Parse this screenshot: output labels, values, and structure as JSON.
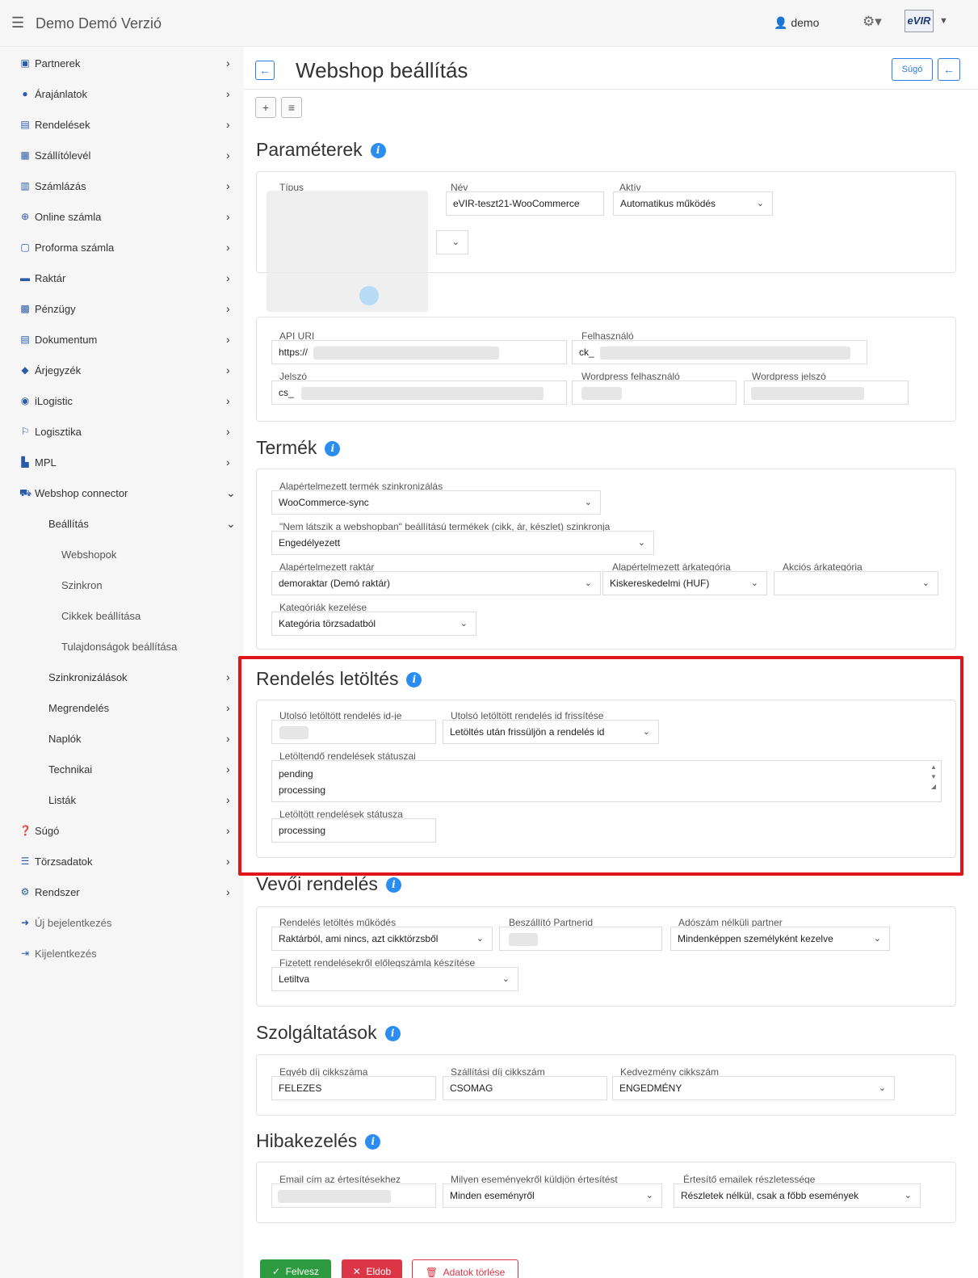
{
  "app": {
    "title": "Demo Demó Verzió",
    "user": "demo",
    "logo": "eVIR"
  },
  "sidebar": {
    "items": [
      {
        "label": "Partnerek",
        "icon": "building-icon"
      },
      {
        "label": "Árajánlatok",
        "icon": "chat-icon"
      },
      {
        "label": "Rendelések",
        "icon": "doc-icon"
      },
      {
        "label": "Szállítólevél",
        "icon": "box-icon"
      },
      {
        "label": "Számlázás",
        "icon": "invoice-icon"
      },
      {
        "label": "Online számla",
        "icon": "globe-icon"
      },
      {
        "label": "Proforma számla",
        "icon": "proforma-icon"
      },
      {
        "label": "Raktár",
        "icon": "warehouse-icon"
      },
      {
        "label": "Pénzügy",
        "icon": "money-icon"
      },
      {
        "label": "Dokumentum",
        "icon": "document-icon"
      },
      {
        "label": "Árjegyzék",
        "icon": "tag-icon"
      },
      {
        "label": "iLogistic",
        "icon": "ilogistic-icon"
      },
      {
        "label": "Logisztika",
        "icon": "truck-icon"
      },
      {
        "label": "MPL",
        "icon": "mpl-icon"
      },
      {
        "label": "Webshop connector",
        "icon": "cart-icon"
      }
    ],
    "sub_items": [
      {
        "label": "Beállítás",
        "level": 2
      },
      {
        "label": "Webshopok",
        "level": 3
      },
      {
        "label": "Szinkron",
        "level": 3
      },
      {
        "label": "Cikkek beállítása",
        "level": 3
      },
      {
        "label": "Tulajdonságok beállítása",
        "level": 3
      },
      {
        "label": "Szinkronizálások",
        "level": 2
      },
      {
        "label": "Megrendelés",
        "level": 2
      },
      {
        "label": "Naplók",
        "level": 2
      },
      {
        "label": "Technikai",
        "level": 2
      },
      {
        "label": "Listák",
        "level": 2
      }
    ],
    "bottom_items": [
      {
        "label": "Súgó",
        "icon": "question-icon"
      },
      {
        "label": "Törzsadatok",
        "icon": "database-icon"
      },
      {
        "label": "Rendszer",
        "icon": "settings-icon"
      },
      {
        "label": "Új bejelentkezés",
        "icon": "login-icon"
      },
      {
        "label": "Kijelentkezés",
        "icon": "logout-icon"
      }
    ]
  },
  "page": {
    "title": "Webshop beállítás",
    "help_label": "Súgó"
  },
  "parameters": {
    "title": "Paraméterek",
    "type_label": "Típus",
    "name_label": "Név",
    "name_value": "eVIR-teszt21-WooCommerce",
    "active_label": "Aktív",
    "active_value": "Automatikus működés"
  },
  "connection": {
    "title": "",
    "api_uri_label": "API URI",
    "api_uri_value": "https://",
    "user_label": "Felhasználó",
    "user_value": "ck_",
    "password_label": "Jelszó",
    "password_value": "cs_",
    "wp_user_label": "Wordpress felhasználó",
    "wp_password_label": "Wordpress jelszó"
  },
  "product": {
    "title": "Termék",
    "sync_label": "Alapértelmezett termék szinkronizálás",
    "sync_value": "WooCommerce-sync",
    "hidden_label": "\"Nem látszik a webshopban\" beállítású termékek (cikk, ár, készlet) szinkronja",
    "hidden_value": "Engedélyezett",
    "warehouse_label": "Alapértelmezett raktár",
    "warehouse_value": "demoraktar (Demó raktár)",
    "price_cat_label": "Alapértelmezett árkategória",
    "price_cat_value": "Kiskereskedelmi (HUF)",
    "sale_cat_label": "Akciós árkategória",
    "sale_cat_value": "",
    "cat_handling_label": "Kategóriák kezelése",
    "cat_handling_value": "Kategória törzsadatból"
  },
  "order_download": {
    "title": "Rendelés letöltés",
    "last_id_label": "Utolsó letöltött rendelés id-je",
    "last_id_refresh_label": "Utolsó letöltött rendelés id frissítése",
    "last_id_refresh_value": "Letöltés után frissüljön a rendelés id",
    "statuses_label": "Letöltendő rendelések státuszai",
    "statuses": [
      "pending",
      "processing"
    ],
    "downloaded_status_label": "Letöltött rendelések státusza",
    "downloaded_status_value": "processing"
  },
  "customer_order": {
    "title": "Vevői rendelés",
    "mode_label": "Rendelés letöltés működés",
    "mode_value": "Raktárból, ami nincs, azt cikktörzsből",
    "supplier_label": "Beszállító Partnerid",
    "no_tax_label": "Adószám nélküli partner",
    "no_tax_value": "Mindenképpen személyként kezelve",
    "prepay_label": "Fizetett rendelésekről előlegszámla készítése",
    "prepay_value": "Letiltva"
  },
  "services": {
    "title": "Szolgáltatások",
    "other_fee_label": "Egyéb díj cikkszáma",
    "other_fee_value": "FELEZES",
    "shipping_label": "Szállítási díj cikkszám",
    "shipping_value": "CSOMAG",
    "discount_label": "Kedvezmény cikkszám",
    "discount_value": "ENGEDMÉNY"
  },
  "errors": {
    "title": "Hibakezelés",
    "email_label": "Email cím az értesítésekhez",
    "events_label": "Milyen eseményekről küldjön értesítést",
    "events_value": "Minden eseményről",
    "detail_label": "Értesítő emailek részletessége",
    "detail_value": "Részletek nélkül, csak a főbb események"
  },
  "actions": {
    "save": "Felvesz",
    "discard": "Eldob",
    "delete": "Adatok törlése"
  },
  "colors": {
    "accent": "#2b7be8",
    "info": "#2b8df0",
    "highlight": "#e0141b",
    "save": "#2e9a3f",
    "discard": "#dc3545"
  }
}
